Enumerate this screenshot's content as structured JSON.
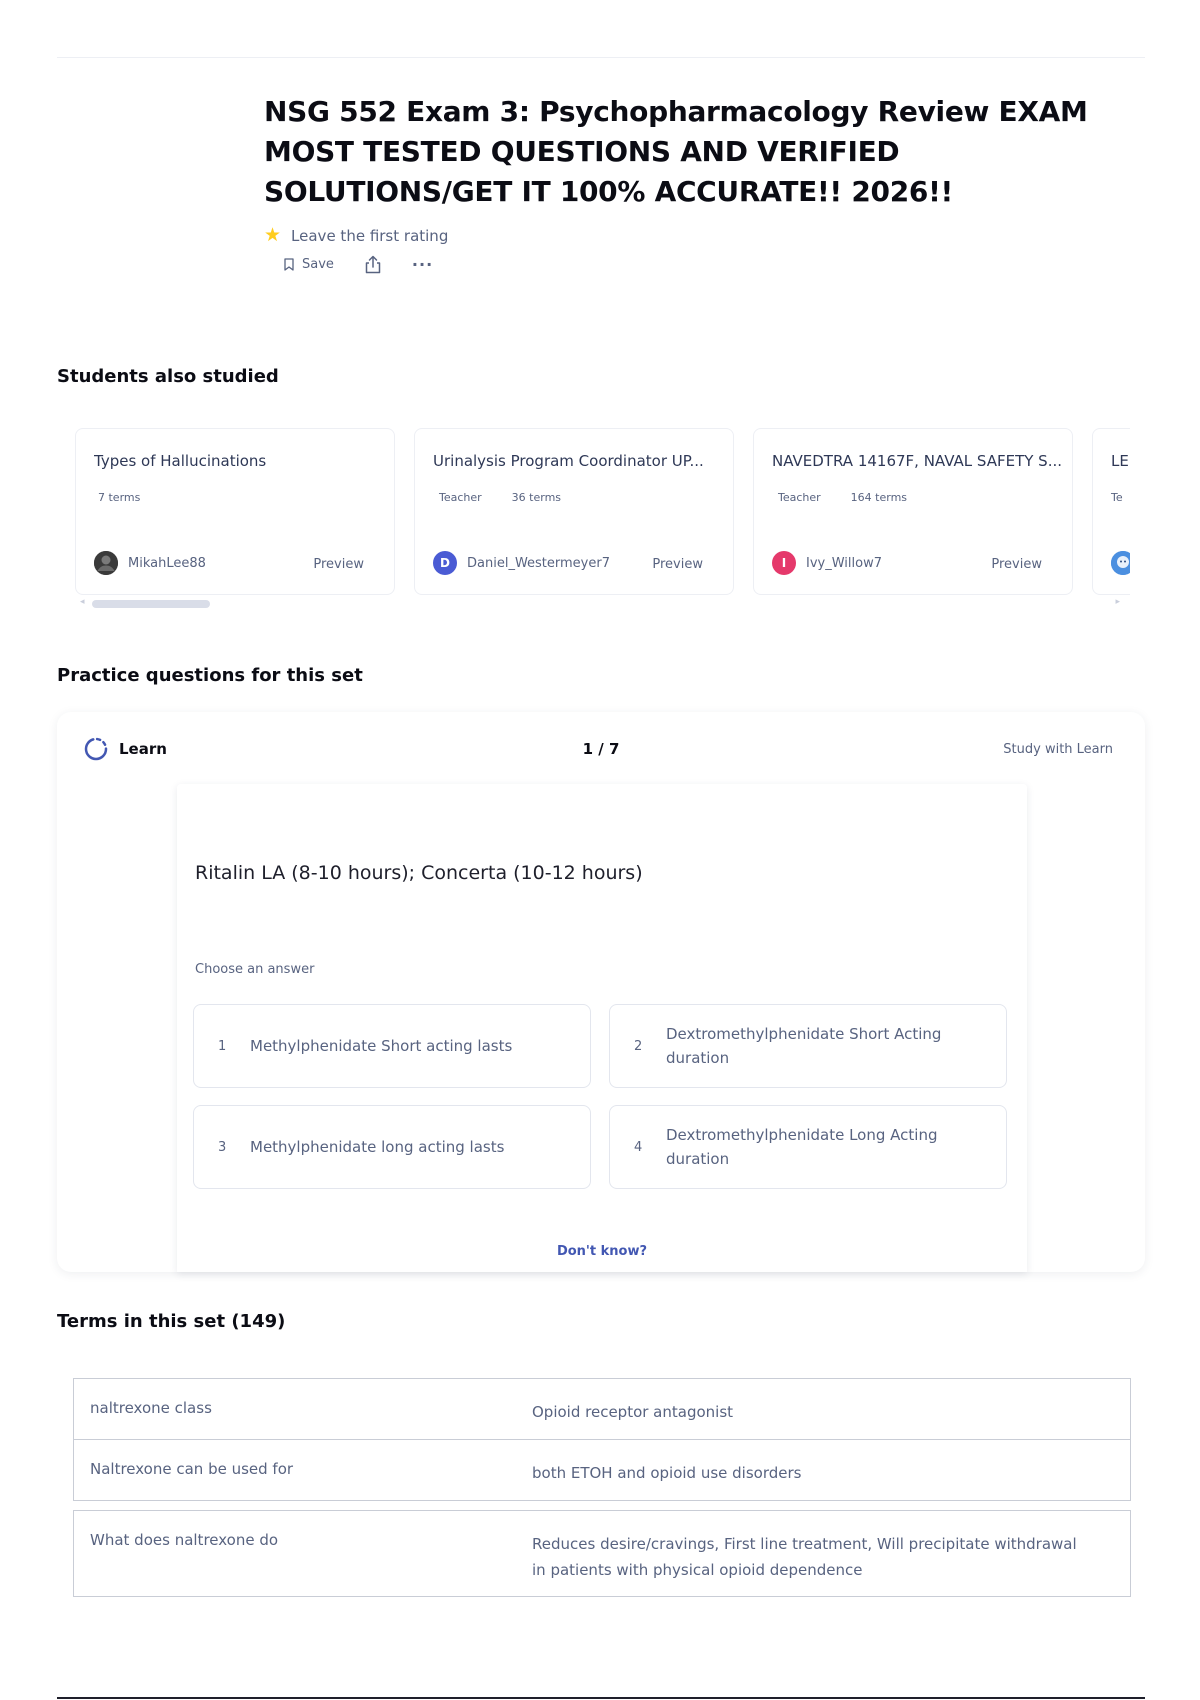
{
  "header": {
    "title": "NSG 552 Exam 3: Psychopharmacology Review EXAM MOST TESTED QUESTIONS AND VERIFIED SOLUTIONS/GET IT 100% ACCURATE!! 2026!!",
    "rating_text": "Leave the first rating",
    "save_label": "Save",
    "more_label": "···"
  },
  "students_also_studied": {
    "heading": "Students also studied",
    "preview_label": "Preview",
    "cards": [
      {
        "title": "Types of Hallucinations",
        "role": "",
        "terms": "7 terms",
        "user": "MikahLee88",
        "avatar_initial": "",
        "avatar_color": "#3a3a3a"
      },
      {
        "title": "Urinalysis Program Coordinator UP...",
        "role": "Teacher",
        "terms": "36 terms",
        "user": "Daniel_Westermeyer7",
        "avatar_initial": "D",
        "avatar_color": "#4a5bd4"
      },
      {
        "title": "NAVEDTRA 14167F, NAVAL SAFETY S...",
        "role": "Teacher",
        "terms": "164 terms",
        "user": "Ivy_Willow7",
        "avatar_initial": "I",
        "avatar_color": "#e5396b"
      },
      {
        "title": "LE",
        "role": "Te",
        "terms": "",
        "user": "",
        "avatar_initial": "",
        "avatar_color": "#4b8fe0"
      }
    ]
  },
  "practice": {
    "heading": "Practice questions for this set",
    "learn_label": "Learn",
    "progress": "1 / 7",
    "study_with_learn": "Study with Learn",
    "question": "Ritalin LA (8-10 hours); Concerta (10-12 hours)",
    "choose_label": "Choose an answer",
    "options": [
      {
        "num": "1",
        "text": "Methylphenidate Short acting lasts"
      },
      {
        "num": "2",
        "text": "Dextromethylphenidate Short Acting duration"
      },
      {
        "num": "3",
        "text": "Methylphenidate long acting lasts"
      },
      {
        "num": "4",
        "text": "Dextromethylphenidate Long Acting duration"
      }
    ],
    "dont_know": "Don't know?"
  },
  "terms": {
    "heading": "Terms in this set (149)",
    "rows": [
      {
        "term": "naltrexone class",
        "definition": "Opioid receptor antagonist"
      },
      {
        "term": "Naltrexone can be used for",
        "definition": "both ETOH and opioid use disorders"
      },
      {
        "term": "What does naltrexone do",
        "definition": "Reduces desire/cravings, First line treatment, Will precipitate withdrawal in patients with physical opioid dependence"
      }
    ]
  },
  "colors": {
    "accent": "#4257b2",
    "star": "#ffcd1f",
    "muted_text": "#586380",
    "heading_text": "#0b0c14"
  }
}
